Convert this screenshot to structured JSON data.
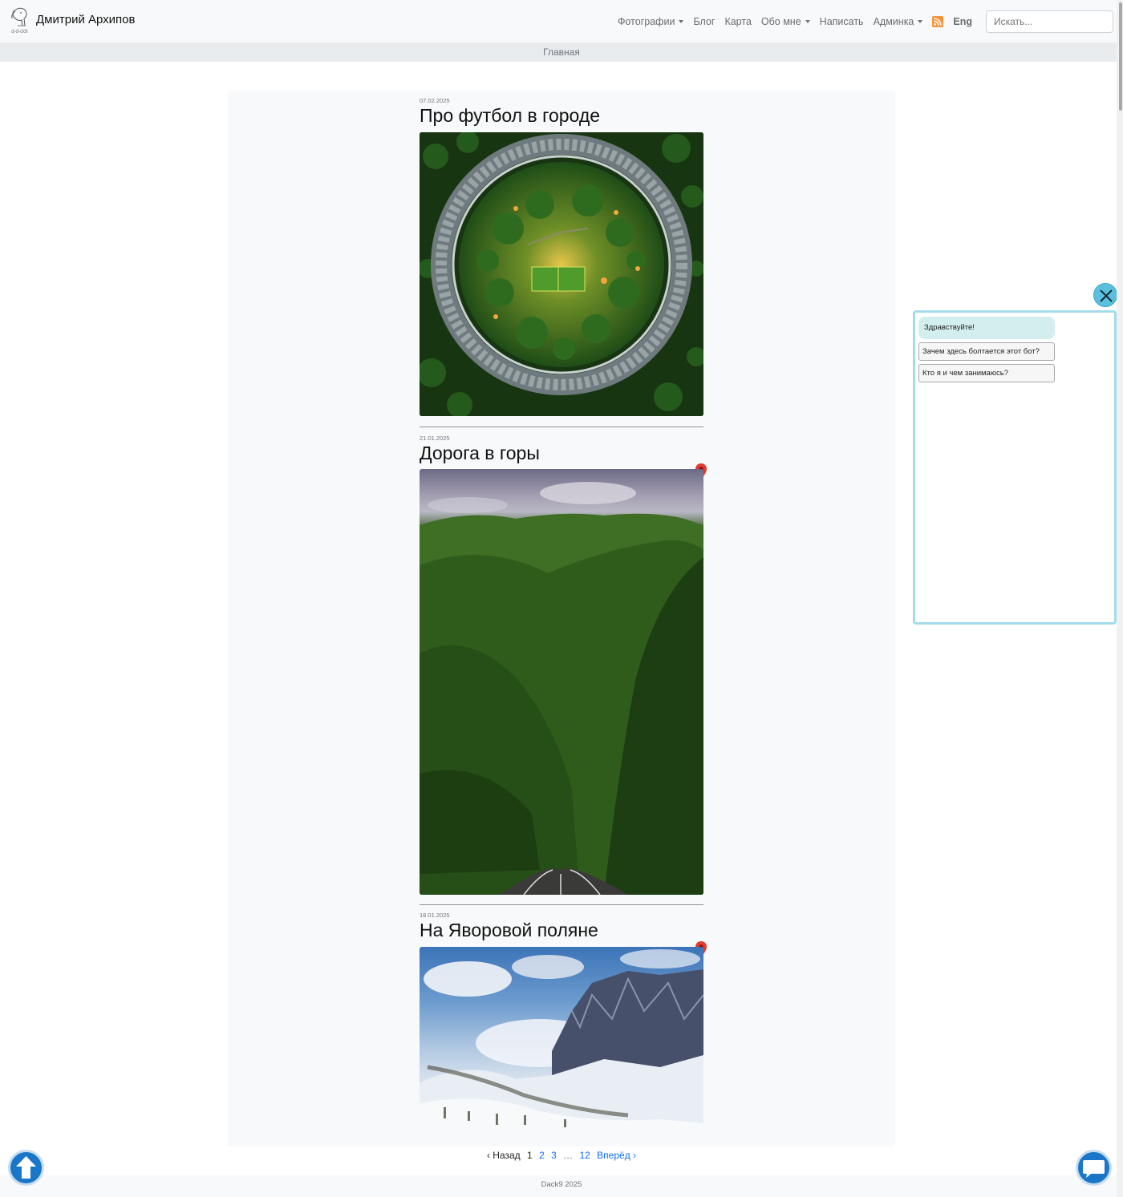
{
  "header": {
    "site_name": "Дмитрий Архипов",
    "logo_text": "d-d-ck9",
    "nav": {
      "photos": "Фотографии",
      "blog": "Блог",
      "map": "Карта",
      "about": "Обо мне",
      "write": "Написать",
      "admin": "Админка",
      "lang": "Eng"
    },
    "search_placeholder": "Искать..."
  },
  "breadcrumb": "Главная",
  "posts": [
    {
      "date": "07.02.2025",
      "title": "Про футбол в городе",
      "has_location": false
    },
    {
      "date": "21.01.2025",
      "title": "Дорога в горы",
      "has_location": true
    },
    {
      "date": "18.01.2025",
      "title": "На Яворовой поляне",
      "has_location": true
    }
  ],
  "chat": {
    "greeting": "Здравствуйте!",
    "options": [
      "Зачем здесь болтается этот бот?",
      "Кто я и чем занимаюсь?"
    ]
  },
  "pagination": {
    "prev": "‹ Назад",
    "current": "1",
    "pages": [
      "2",
      "3"
    ],
    "ellipsis": "…",
    "last": "12",
    "next": "Вперёд ›"
  },
  "footer": "Dack9 2025",
  "colors": {
    "accent": "#1a76c9",
    "chat_border": "#a3dcea",
    "link": "#0d6efd",
    "pin": "#e03b2f"
  }
}
